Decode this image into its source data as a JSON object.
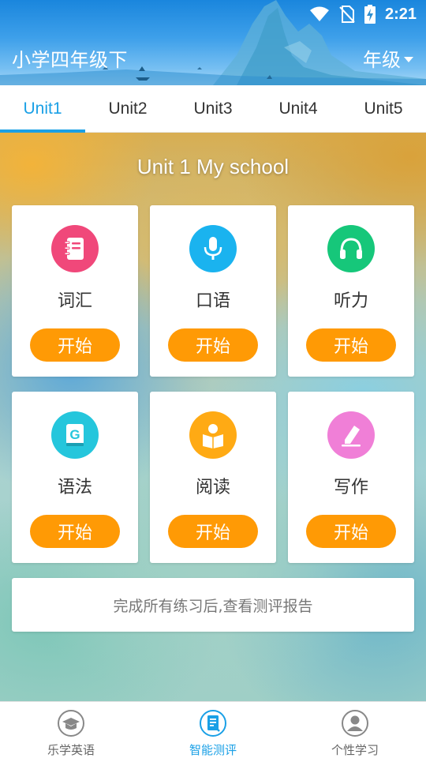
{
  "status_bar": {
    "time": "2:21",
    "icons": [
      "wifi-icon",
      "no-sim-icon",
      "battery-charging-icon"
    ]
  },
  "header": {
    "title": "小学四年级下",
    "grade_label": "年级"
  },
  "tabs": [
    {
      "label": "Unit1",
      "active": true
    },
    {
      "label": "Unit2",
      "active": false
    },
    {
      "label": "Unit3",
      "active": false
    },
    {
      "label": "Unit4",
      "active": false
    },
    {
      "label": "Unit5",
      "active": false
    }
  ],
  "unit_title": "Unit 1 My school",
  "cards": [
    {
      "label": "词汇",
      "button": "开始",
      "icon": "notebook-icon",
      "color": "#f0487a"
    },
    {
      "label": "口语",
      "button": "开始",
      "icon": "microphone-icon",
      "color": "#1ab3ef"
    },
    {
      "label": "听力",
      "button": "开始",
      "icon": "headphones-icon",
      "color": "#16c77a"
    },
    {
      "label": "语法",
      "button": "开始",
      "icon": "grammar-book-icon",
      "color": "#25c6dc"
    },
    {
      "label": "阅读",
      "button": "开始",
      "icon": "reading-icon",
      "color": "#ffaa14"
    },
    {
      "label": "写作",
      "button": "开始",
      "icon": "pencil-icon",
      "color": "#f07fd7"
    }
  ],
  "report_text": "完成所有练习后,查看测评报告",
  "bottom_nav": [
    {
      "label": "乐学英语",
      "icon": "graduation-cap-icon",
      "active": false
    },
    {
      "label": "智能测评",
      "icon": "assessment-icon",
      "active": true
    },
    {
      "label": "个性学习",
      "icon": "person-icon",
      "active": false
    }
  ],
  "colors": {
    "accent": "#1aa0e6",
    "button": "#ff9a05"
  }
}
